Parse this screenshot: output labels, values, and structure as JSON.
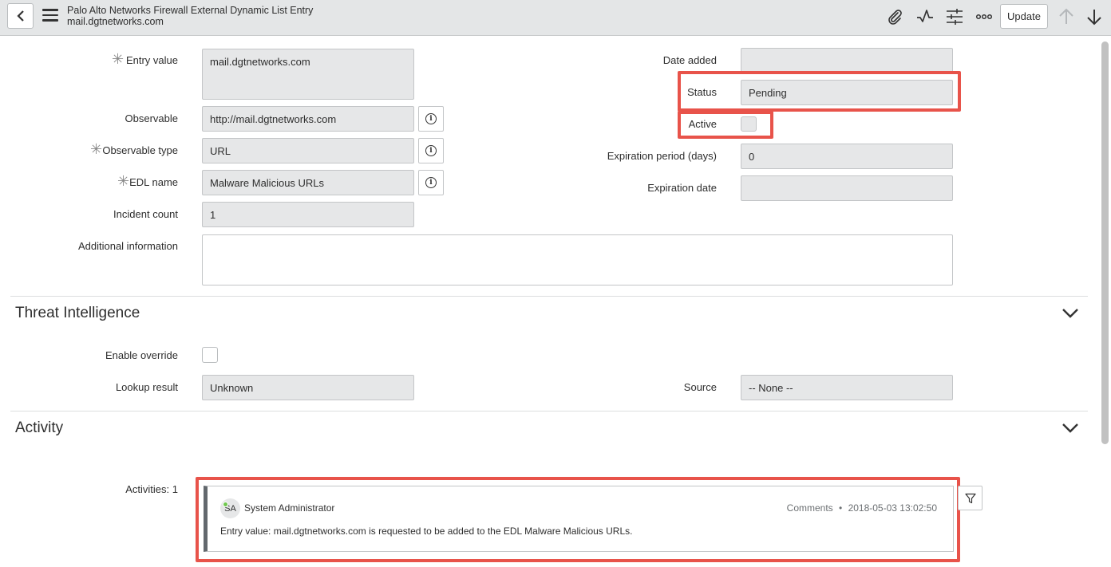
{
  "header": {
    "title": "Palo Alto Networks Firewall External Dynamic List Entry",
    "subtitle": "mail.dgtnetworks.com",
    "update_label": "Update"
  },
  "form": {
    "entry_value": {
      "label": "Entry value",
      "value": "mail.dgtnetworks.com"
    },
    "observable": {
      "label": "Observable",
      "value": "http://mail.dgtnetworks.com"
    },
    "observable_type": {
      "label": "Observable type",
      "value": "URL"
    },
    "edl_name": {
      "label": "EDL name",
      "value": "Malware Malicious URLs"
    },
    "incident_count": {
      "label": "Incident count",
      "value": "1"
    },
    "additional_info": {
      "label": "Additional information",
      "value": ""
    },
    "date_added": {
      "label": "Date added",
      "value": ""
    },
    "status": {
      "label": "Status",
      "value": "Pending"
    },
    "active": {
      "label": "Active",
      "checked": false
    },
    "expiration_period": {
      "label": "Expiration period (days)",
      "value": "0"
    },
    "expiration_date": {
      "label": "Expiration date",
      "value": ""
    }
  },
  "threat_intel": {
    "title": "Threat Intelligence",
    "enable_override": {
      "label": "Enable override",
      "checked": false
    },
    "lookup_result": {
      "label": "Lookup result",
      "value": "Unknown"
    },
    "source": {
      "label": "Source",
      "value": "-- None --"
    }
  },
  "activity": {
    "title": "Activity",
    "count_label": "Activities: 1",
    "entry": {
      "initials": "SA",
      "author": "System Administrator",
      "type": "Comments",
      "separator": "•",
      "timestamp": "2018-05-03 13:02:50",
      "text": "Entry value: mail.dgtnetworks.com is requested to be added to the EDL Malware Malicious URLs."
    }
  },
  "icons": [
    "back-icon",
    "menu-icon",
    "paperclip-icon",
    "activity-icon",
    "settings-sliders-icon",
    "more-icon",
    "arrow-up-icon",
    "arrow-down-icon",
    "info-icon",
    "chevron-down-icon",
    "filter-icon"
  ],
  "colors": {
    "highlight": "#e8534a",
    "field_bg": "#e6e7e8",
    "header_bg": "#e4e6e7"
  }
}
